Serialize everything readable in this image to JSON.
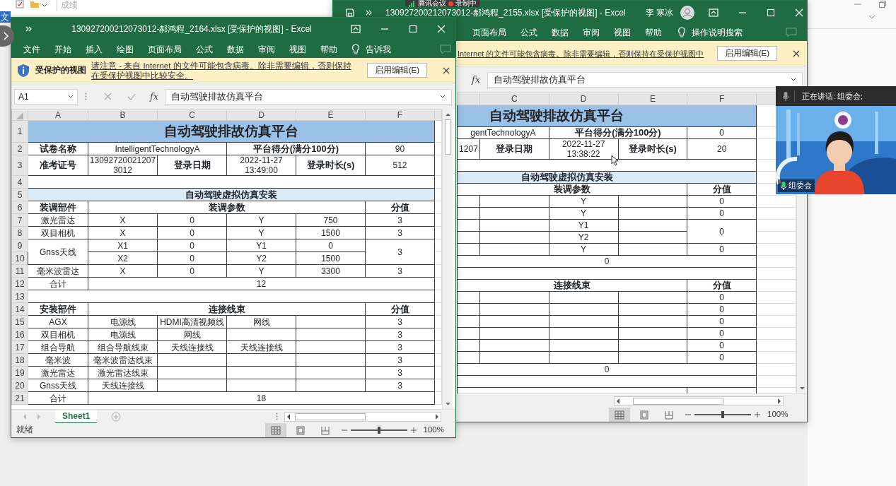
{
  "explorer": {
    "tab_label": "文",
    "path_text": "成绩"
  },
  "meeting_bar": {
    "app": "腾讯会议",
    "recording": "录制中"
  },
  "back_window": {
    "title": "130927200212073012-郝鸿程_2155.xlsx [受保护的视图] - Excel",
    "user": "李 寒冰",
    "ribbon_tabs": [
      "页面布局",
      "公式",
      "数据",
      "审阅",
      "视图",
      "帮助"
    ],
    "tell_me": "操作说明搜索",
    "protected_message": "Internet 的文件可能包含病毒。除非需要编辑，否则保持在受保护视图中",
    "enable_button": "启用编辑(E)",
    "function_label": "fx",
    "formula": "自动驾驶排故仿真平台",
    "columns": [
      "",
      "C",
      "D",
      "E",
      "F"
    ],
    "rows": [
      {
        "cells": [
          {
            "text": "自动驾驶排故仿真平台",
            "colspan": 5,
            "kind": "title"
          }
        ]
      },
      {
        "cells": [
          {
            "text": "gentTechnologyA",
            "colspan": 2,
            "kind": "plain"
          },
          {
            "text": "平台得分(满分100分)",
            "colspan": 2,
            "kind": "bold"
          },
          {
            "text": "0",
            "kind": "plain"
          }
        ]
      },
      {
        "cells": [
          {
            "text": "1207",
            "kind": "plain"
          },
          {
            "text": "登录日期",
            "kind": "bold"
          },
          {
            "text": "2022-11-27 13:38:22",
            "kind": "plain"
          },
          {
            "text": "登录时长(s)",
            "kind": "bold"
          },
          {
            "text": "20",
            "kind": "plain"
          }
        ]
      },
      {
        "cells": [
          {
            "colspan": 5
          }
        ]
      },
      {
        "cells": [
          {
            "text": "自动驾驶虚拟仿真安装",
            "colspan": 5,
            "kind": "section"
          }
        ]
      },
      {
        "cells": [
          {
            "text": "装调参数",
            "colspan": 4,
            "kind": "bold"
          },
          {
            "text": "分值",
            "kind": "bold"
          }
        ]
      },
      {
        "cells": [
          {},
          {},
          {
            "text": "Y",
            "kind": "plain"
          },
          {},
          {
            "text": "0",
            "kind": "plain"
          }
        ]
      },
      {
        "cells": [
          {},
          {},
          {
            "text": "Y",
            "kind": "plain"
          },
          {},
          {
            "text": "0",
            "kind": "plain"
          }
        ]
      },
      {
        "cells": [
          {},
          {},
          {
            "text": "Y1",
            "kind": "plain"
          },
          {},
          {
            "text": "0",
            "rowspan": 2,
            "kind": "plain"
          }
        ]
      },
      {
        "cells": [
          {},
          {},
          {
            "text": "Y2",
            "kind": "plain"
          },
          {}
        ]
      },
      {
        "cells": [
          {},
          {},
          {
            "text": "Y",
            "kind": "plain"
          },
          {},
          {
            "text": "0",
            "kind": "plain"
          }
        ]
      },
      {
        "cells": [
          {
            "text": "0",
            "colspan": 5,
            "kind": "plain"
          }
        ]
      },
      {
        "cells": [
          {
            "colspan": 5
          }
        ]
      },
      {
        "cells": [
          {
            "text": "连接线束",
            "colspan": 4,
            "kind": "bold"
          },
          {
            "text": "分值",
            "kind": "bold"
          }
        ]
      },
      {
        "cells": [
          {},
          {},
          {},
          {},
          {
            "text": "0",
            "kind": "plain"
          }
        ]
      },
      {
        "cells": [
          {},
          {},
          {},
          {},
          {
            "text": "0",
            "kind": "plain"
          }
        ]
      },
      {
        "cells": [
          {},
          {},
          {},
          {},
          {
            "text": "0",
            "kind": "plain"
          }
        ]
      },
      {
        "cells": [
          {},
          {},
          {},
          {},
          {
            "text": "0",
            "kind": "plain"
          }
        ]
      },
      {
        "cells": [
          {},
          {},
          {},
          {},
          {
            "text": "0",
            "kind": "plain"
          }
        ]
      },
      {
        "cells": [
          {},
          {},
          {},
          {},
          {
            "text": "0",
            "kind": "plain"
          }
        ]
      },
      {
        "cells": [
          {
            "text": "0",
            "colspan": 5,
            "kind": "plain"
          }
        ]
      },
      {
        "cells": [
          {
            "colspan": 5
          }
        ]
      },
      {
        "cells": [
          {
            "colspan": 4
          },
          {}
        ]
      }
    ],
    "view_buttons": [
      {
        "kind": "normal",
        "selected": true
      },
      {
        "kind": "page_layout",
        "selected": false
      },
      {
        "kind": "page_break",
        "selected": false
      }
    ],
    "zoom": {
      "level": 0.5,
      "reading": "100%"
    }
  },
  "front_window": {
    "title": "130927200212073012-郝鸿程_2164.xlsx [受保护的视图] - Excel",
    "ribbon_tabs": [
      "文件",
      "开始",
      "插入",
      "绘图",
      "页面布局",
      "公式",
      "数据",
      "审阅",
      "视图",
      "帮助"
    ],
    "tell_me": "告诉我",
    "protected_label": "受保护的视图",
    "protected_message": "请注意 - 来自 Internet 的文件可能包含病毒。除非需要编辑，否则保持在受保护视图中比较安全。",
    "enable_button": "启用编辑(E)",
    "name_box": "A1",
    "function_label": "fx",
    "formula": "自动驾驶排故仿真平台",
    "columns": [
      "A",
      "B",
      "C",
      "D",
      "E",
      "F"
    ],
    "rows": [
      {
        "number": "1",
        "cells": [
          {
            "text": "自动驾驶排故仿真平台",
            "colspan": 6,
            "kind": "title"
          }
        ]
      },
      {
        "number": "2",
        "cells": [
          {
            "text": "试卷名称",
            "kind": "bold"
          },
          {
            "text": "IntelligentTechnologyA",
            "colspan": 2,
            "kind": "plain"
          },
          {
            "text": "平台得分(满分100分)",
            "colspan": 2,
            "kind": "bold"
          },
          {
            "text": "90",
            "kind": "plain"
          }
        ]
      },
      {
        "number": "3",
        "cells": [
          {
            "text": "准考证号",
            "kind": "bold"
          },
          {
            "text": "130927200212073012",
            "kind": "plain"
          },
          {
            "text": "登录日期",
            "kind": "bold"
          },
          {
            "text": "2022-11-27 13:49:00",
            "kind": "plain"
          },
          {
            "text": "登录时长(s)",
            "kind": "bold"
          },
          {
            "text": "512",
            "kind": "plain"
          }
        ]
      },
      {
        "number": "4",
        "cells": [
          {
            "colspan": 6
          }
        ]
      },
      {
        "number": "5",
        "cells": [
          {
            "text": "自动驾驶虚拟仿真安装",
            "colspan": 6,
            "kind": "section"
          }
        ]
      },
      {
        "number": "6",
        "cells": [
          {
            "text": "装调部件",
            "kind": "bold"
          },
          {
            "text": "装调参数",
            "colspan": 4,
            "kind": "bold"
          },
          {
            "text": "分值",
            "kind": "bold"
          }
        ]
      },
      {
        "number": "7",
        "cells": [
          {
            "text": "激光雷达",
            "kind": "plain"
          },
          {
            "text": "X",
            "kind": "plain"
          },
          {
            "text": "0",
            "kind": "plain"
          },
          {
            "text": "Y",
            "kind": "plain"
          },
          {
            "text": "750",
            "kind": "plain"
          },
          {
            "text": "3",
            "kind": "plain"
          }
        ]
      },
      {
        "number": "8",
        "cells": [
          {
            "text": "双目相机",
            "kind": "plain"
          },
          {
            "text": "X",
            "kind": "plain"
          },
          {
            "text": "0",
            "kind": "plain"
          },
          {
            "text": "Y",
            "kind": "plain"
          },
          {
            "text": "1500",
            "kind": "plain"
          },
          {
            "text": "3",
            "kind": "plain"
          }
        ]
      },
      {
        "number": "9",
        "cells": [
          {
            "text": "Gnss天线",
            "rowspan": 2,
            "kind": "plain"
          },
          {
            "text": "X1",
            "kind": "plain"
          },
          {
            "text": "0",
            "kind": "plain"
          },
          {
            "text": "Y1",
            "kind": "plain"
          },
          {
            "text": "0",
            "kind": "plain"
          },
          {
            "text": "3",
            "rowspan": 2,
            "kind": "plain"
          }
        ]
      },
      {
        "number": "10",
        "cells": [
          {
            "text": "X2",
            "kind": "plain"
          },
          {
            "text": "0",
            "kind": "plain"
          },
          {
            "text": "Y2",
            "kind": "plain"
          },
          {
            "text": "1500",
            "kind": "plain"
          }
        ]
      },
      {
        "number": "11",
        "cells": [
          {
            "text": "毫米波雷达",
            "kind": "plain"
          },
          {
            "text": "X",
            "kind": "plain"
          },
          {
            "text": "0",
            "kind": "plain"
          },
          {
            "text": "Y",
            "kind": "plain"
          },
          {
            "text": "3300",
            "kind": "plain"
          },
          {
            "text": "3",
            "kind": "plain"
          }
        ]
      },
      {
        "number": "12",
        "cells": [
          {
            "text": "合计",
            "kind": "plain"
          },
          {
            "text": "12",
            "colspan": 5,
            "kind": "plain"
          }
        ]
      },
      {
        "number": "13",
        "cells": [
          {
            "colspan": 6
          }
        ]
      },
      {
        "number": "14",
        "cells": [
          {
            "text": "安装部件",
            "kind": "bold"
          },
          {
            "text": "连接线束",
            "colspan": 4,
            "kind": "bold"
          },
          {
            "text": "分值",
            "kind": "bold"
          }
        ]
      },
      {
        "number": "15",
        "cells": [
          {
            "text": "AGX",
            "kind": "plain"
          },
          {
            "text": "电源线",
            "kind": "plain"
          },
          {
            "text": "HDMI高清视频线",
            "kind": "plain"
          },
          {
            "text": "网线",
            "kind": "plain"
          },
          {},
          {
            "text": "3",
            "kind": "plain"
          }
        ]
      },
      {
        "number": "16",
        "cells": [
          {
            "text": "双目相机",
            "kind": "plain"
          },
          {
            "text": "电源线",
            "kind": "plain"
          },
          {
            "text": "网线",
            "kind": "plain"
          },
          {},
          {},
          {
            "text": "3",
            "kind": "plain"
          }
        ]
      },
      {
        "number": "17",
        "cells": [
          {
            "text": "组合导航",
            "kind": "plain"
          },
          {
            "text": "组合导航线束",
            "kind": "plain"
          },
          {
            "text": "天线连接线",
            "kind": "plain"
          },
          {
            "text": "天线连接线",
            "kind": "plain"
          },
          {},
          {
            "text": "3",
            "kind": "plain"
          }
        ]
      },
      {
        "number": "18",
        "cells": [
          {
            "text": "毫米波",
            "kind": "plain"
          },
          {
            "text": "毫米波雷达线束",
            "kind": "plain"
          },
          {},
          {},
          {},
          {
            "text": "3",
            "kind": "plain"
          }
        ]
      },
      {
        "number": "19",
        "cells": [
          {
            "text": "激光雷达",
            "kind": "plain"
          },
          {
            "text": "激光雷达线束",
            "kind": "plain"
          },
          {},
          {},
          {},
          {
            "text": "3",
            "kind": "plain"
          }
        ]
      },
      {
        "number": "20",
        "cells": [
          {
            "text": "Gnss天线",
            "kind": "plain"
          },
          {
            "text": "天线连接线",
            "kind": "plain"
          },
          {},
          {},
          {},
          {
            "text": "3",
            "kind": "plain"
          }
        ]
      },
      {
        "number": "21",
        "cells": [
          {
            "text": "合计",
            "kind": "plain"
          },
          {
            "text": "18",
            "colspan": 5,
            "kind": "plain"
          }
        ]
      }
    ],
    "sheet_tabs": [
      {
        "label": "Sheet1",
        "selected": true
      }
    ],
    "status": "就绪",
    "view_buttons": [
      {
        "kind": "normal",
        "selected": true
      },
      {
        "kind": "page_layout",
        "selected": false
      },
      {
        "kind": "page_break",
        "selected": false
      }
    ],
    "zoom": {
      "level": 0.5,
      "reading": "100%"
    }
  },
  "video_panel": {
    "speaking": "正在讲话: 组委会;",
    "participant": "组委会"
  }
}
